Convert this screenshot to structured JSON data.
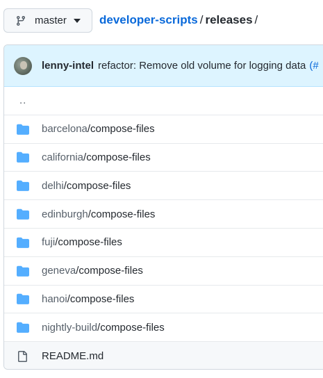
{
  "branch": {
    "label": "master"
  },
  "breadcrumb": {
    "repo": "developer-scripts",
    "sep1": "/",
    "dir": "releases",
    "sep2": "/"
  },
  "commit": {
    "author": "lenny-intel",
    "message": "refactor: Remove old volume for logging data",
    "link": "(#"
  },
  "listing": {
    "parent": "..",
    "folders": [
      {
        "dir": "barcelona",
        "sub": "/compose-files"
      },
      {
        "dir": "california",
        "sub": "/compose-files"
      },
      {
        "dir": "delhi",
        "sub": "/compose-files"
      },
      {
        "dir": "edinburgh",
        "sub": "/compose-files"
      },
      {
        "dir": "fuji",
        "sub": "/compose-files"
      },
      {
        "dir": "geneva",
        "sub": "/compose-files"
      },
      {
        "dir": "hanoi",
        "sub": "/compose-files"
      },
      {
        "dir": "nightly-build",
        "sub": "/compose-files"
      }
    ],
    "file": "README.md"
  },
  "colors": {
    "link": "#0969da",
    "folder": "#54aeff",
    "commit_bg": "#ddf4ff"
  }
}
